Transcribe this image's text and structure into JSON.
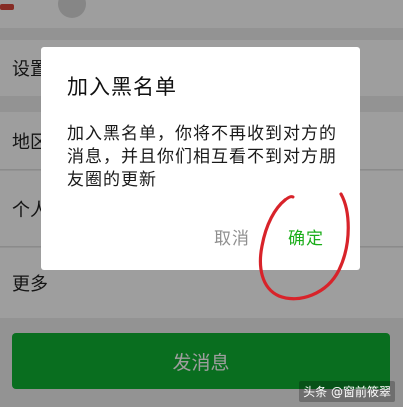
{
  "background": {
    "rows": {
      "settings": "设置",
      "region": "地区",
      "personal": "个人",
      "more": "更多"
    },
    "send_button_label": "发消息"
  },
  "dialog": {
    "title": "加入黑名单",
    "message": "加入黑名单，你将不再收到对方的消息，并且你们相互看不到对方朋友圈的更新",
    "cancel_label": "取消",
    "confirm_label": "确定"
  },
  "watermark": "头条 @窗前筱翠",
  "colors": {
    "accent_green": "#1aad19",
    "send_button_green": "#0fb233",
    "annotation_red": "#d8232a"
  },
  "icons": {
    "annotation": "hand-drawn-circle"
  }
}
